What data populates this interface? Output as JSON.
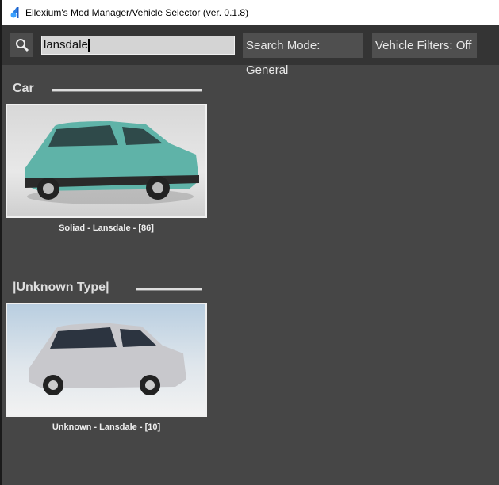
{
  "window": {
    "title": "Ellexium's Mod Manager/Vehicle Selector (ver. 0.1.8)"
  },
  "toolbar": {
    "search_value": "lansdale",
    "search_mode_label": "Search Mode: General",
    "vehicle_filters_label": "Vehicle Filters:  Off"
  },
  "sections": [
    {
      "title": "Car",
      "items": [
        {
          "caption": "Soliad - Lansdale - [86]"
        }
      ]
    },
    {
      "title": "|Unknown Type|",
      "items": [
        {
          "caption": "Unknown - Lansdale - [10]"
        }
      ]
    }
  ]
}
